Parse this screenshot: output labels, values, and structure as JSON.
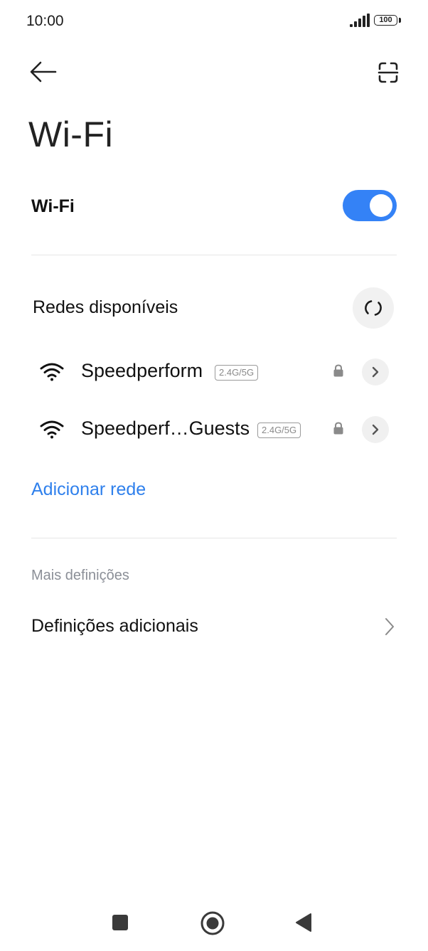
{
  "status_bar": {
    "time": "10:00",
    "battery": "100",
    "icons": [
      "signal-icon",
      "battery-icon"
    ]
  },
  "app_bar": {
    "back_icon": "arrow-left-icon",
    "scan_icon": "qr-scan-icon"
  },
  "page": {
    "title": "Wi-Fi"
  },
  "wifi_toggle": {
    "label": "Wi-Fi",
    "state": "on",
    "color": "#3482f6"
  },
  "available_networks": {
    "title": "Redes disponíveis",
    "refresh_icon": "refresh-icon",
    "networks": [
      {
        "name": "Speedperform",
        "band": "2.4G/5G",
        "secured": true
      },
      {
        "name": "Speedperf…Guests",
        "band": "2.4G/5G",
        "secured": true
      }
    ]
  },
  "add_network": {
    "label": "Adicionar rede",
    "color": "#2f80ec"
  },
  "more_settings": {
    "caption": "Mais definições",
    "items": [
      {
        "label": "Definições adicionais"
      }
    ]
  },
  "nav_bar": {
    "icons": [
      "recents-square-icon",
      "home-circle-icon",
      "back-triangle-icon"
    ]
  }
}
